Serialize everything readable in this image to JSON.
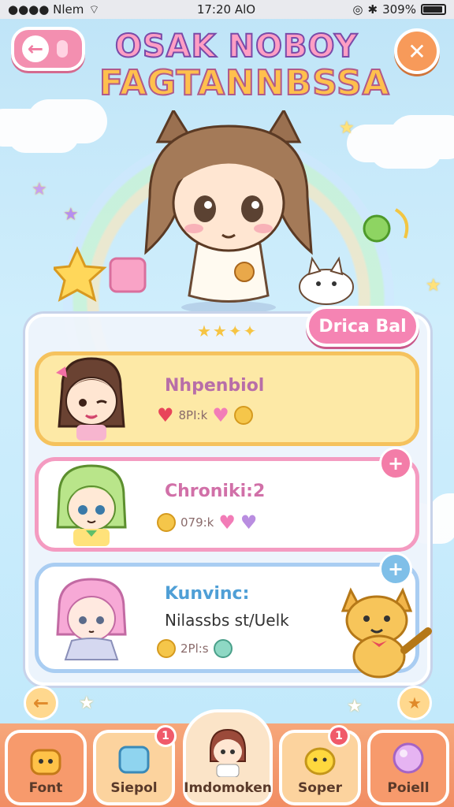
{
  "status_bar": {
    "carrier": "●●●● Nlem",
    "time": "17:20 AlO",
    "battery": "309%"
  },
  "header": {
    "title_line1": "OSAK NOBOY",
    "title_line2": "FAGTANNBSSA"
  },
  "daily_button_label": "Drica Bal",
  "cards": [
    {
      "name": "Nhpenbiol",
      "stat": "8PI:k"
    },
    {
      "name": "Chroniki:2",
      "stat": "079:k"
    },
    {
      "name": "Kunvinc:",
      "subtitle": "Nilassbs st/Uelk",
      "stat": "2Pl:s"
    }
  ],
  "tabs": [
    {
      "label": "Font"
    },
    {
      "label": "Siepol",
      "badge": "1"
    },
    {
      "label": "Imdomoken"
    },
    {
      "label": "Soper",
      "badge": "1"
    },
    {
      "label": "Poiell"
    }
  ],
  "colors": {
    "accent_pink": "#f584b3",
    "accent_orange": "#f79a5a",
    "card_gold": "#fde9a6"
  }
}
